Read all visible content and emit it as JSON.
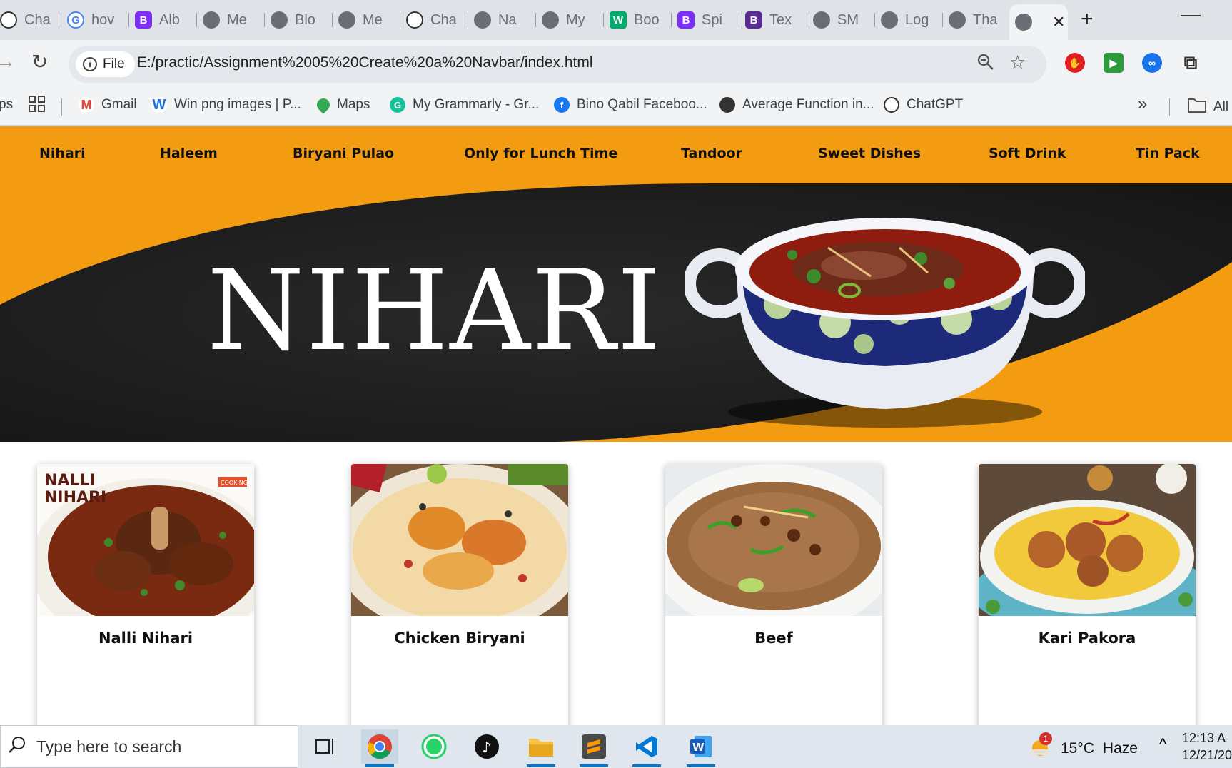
{
  "browser": {
    "tabs": [
      {
        "label": "Cha",
        "icon": "chatgpt-icon"
      },
      {
        "label": "hov",
        "icon": "google-icon"
      },
      {
        "label": "Alb",
        "icon": "bootstrap-icon"
      },
      {
        "label": "Me",
        "icon": "globe-icon"
      },
      {
        "label": "Blo",
        "icon": "globe-icon"
      },
      {
        "label": "Me",
        "icon": "globe-icon"
      },
      {
        "label": "Cha",
        "icon": "chatgpt-icon"
      },
      {
        "label": "Na",
        "icon": "globe-icon"
      },
      {
        "label": "My",
        "icon": "globe-icon"
      },
      {
        "label": "Boo",
        "icon": "w3schools-icon"
      },
      {
        "label": "Spi",
        "icon": "bootstrap-icon"
      },
      {
        "label": "Tex",
        "icon": "bootstrap-icon"
      },
      {
        "label": "SM",
        "icon": "globe-icon"
      },
      {
        "label": "Log",
        "icon": "globe-icon"
      },
      {
        "label": "Tha",
        "icon": "globe-icon"
      }
    ],
    "active_tab_close": "✕",
    "new_tab": "+",
    "minimize": "—",
    "chip_label": "File",
    "url": "E:/practic/Assignment%2005%20Create%20a%20Navbar/index.html",
    "bookmarks": [
      {
        "label": "Gmail",
        "icon": "gmail-icon"
      },
      {
        "label": "Win png images | P...",
        "icon": "winpng-icon"
      },
      {
        "label": "Maps",
        "icon": "maps-pin-icon"
      },
      {
        "label": "My Grammarly - Gr...",
        "icon": "grammarly-icon"
      },
      {
        "label": "Bino Qabil Faceboo...",
        "icon": "facebook-icon"
      },
      {
        "label": "Average Function in...",
        "icon": "globe-icon"
      },
      {
        "label": "ChatGPT",
        "icon": "chatgpt-icon"
      }
    ],
    "bookmarks_left_partial": "ps",
    "bookmarks_more": "»",
    "all_bookmarks": "All"
  },
  "page": {
    "nav_items": [
      "Nihari",
      "Haleem",
      "Biryani Pulao",
      "Only for Lunch Time",
      "Tandoor",
      "Sweet Dishes",
      "Soft Drink",
      "Tin Pack"
    ],
    "hero_title": "NIHARI",
    "cards": [
      {
        "name": "Nalli Nihari",
        "overlay_text_1": "NALLI",
        "overlay_text_2": "NIHARI",
        "overlay_badge": "COOKING"
      },
      {
        "name": "Chicken Biryani"
      },
      {
        "name": "Beef"
      },
      {
        "name": "Kari Pakora"
      }
    ],
    "colors": {
      "accent": "#f39c12",
      "hero_dark": "#1c1c1c"
    }
  },
  "taskbar": {
    "search_placeholder": "Type here to search",
    "weather_temp": "15°C",
    "weather_desc": "Haze",
    "weather_badge": "1",
    "time": "12:13 A",
    "date": "12/21/20"
  }
}
